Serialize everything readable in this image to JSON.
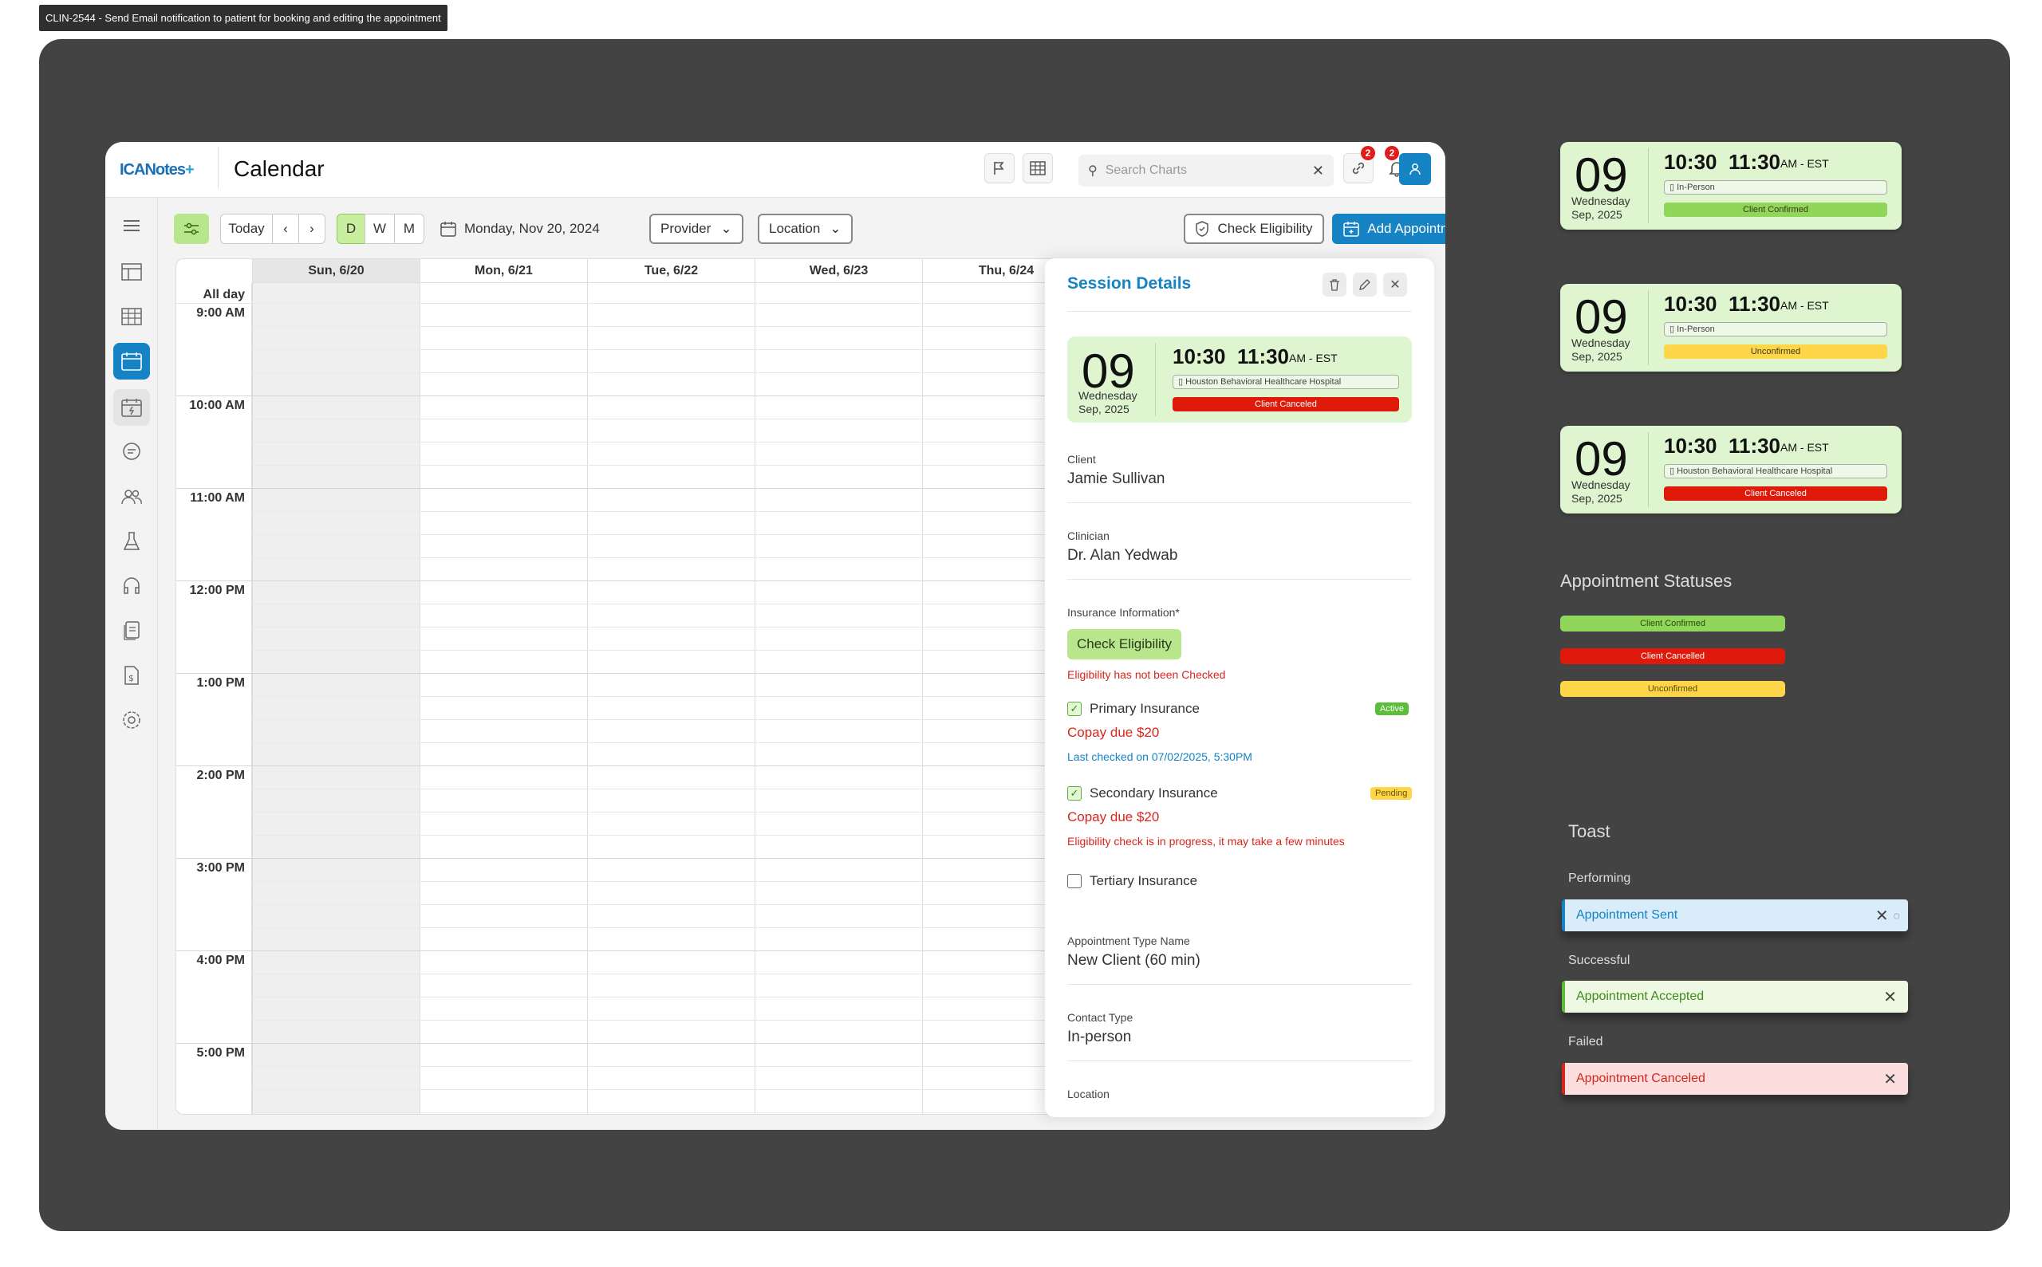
{
  "ticket": "CLIN-2544 - Send Email notification to patient for booking and editing the appointment",
  "app": {
    "logo": "ICANotes",
    "logo_mark": "+",
    "title": "Calendar",
    "search_placeholder": "Search Charts",
    "link_badge": "2",
    "bell_badge": "2"
  },
  "toolbar": {
    "today": "Today",
    "prev": "‹",
    "next": "›",
    "view_d": "D",
    "view_w": "W",
    "view_m": "M",
    "date": "Monday, Nov 20, 2024",
    "provider": "Provider",
    "location": "Location",
    "check_eligibility": "Check Eligibility",
    "add_appointment": "Add Appointment"
  },
  "calendar": {
    "days": [
      "Sun, 6/20",
      "Mon, 6/21",
      "Tue, 6/22",
      "Wed, 6/23",
      "Thu, 6/24"
    ],
    "all_day": "All day",
    "hours": [
      "9:00 AM",
      "10:00 AM",
      "11:00 AM",
      "12:00 PM",
      "1:00 PM",
      "2:00 PM",
      "3:00 PM",
      "4:00 PM",
      "5:00 PM"
    ]
  },
  "panel": {
    "title": "Session Details",
    "card": {
      "day": "09",
      "dow": "Wednesday",
      "date": "Sep, 2025",
      "start": "10:30",
      "end": "11:30",
      "tz": "AM - EST",
      "location": "Houston Behavioral Healthcare Hospital",
      "status": "Client Canceled"
    },
    "client_label": "Client",
    "client": "Jamie Sullivan",
    "clinician_label": "Clinician",
    "clinician": "Dr. Alan Yedwab",
    "insurance_label": "Insurance Information*",
    "check_eligibility": "Check Eligibility",
    "eligibility_note": "Eligibility has not been Checked",
    "primary": "Primary Insurance",
    "primary_badge": "Active",
    "primary_copay": "Copay due $20",
    "primary_checked": "Last checked on 07/02/2025, 5:30PM",
    "secondary": "Secondary Insurance",
    "secondary_badge": "Pending",
    "secondary_copay": "Copay due $20",
    "secondary_note": "Eligibility check is in progress, it may take a few minutes",
    "tertiary": "Tertiary Insurance",
    "appt_type_label": "Appointment Type Name",
    "appt_type": "New Client (60 min)",
    "contact_label": "Contact Type",
    "contact": "In-person",
    "location_label": "Location"
  },
  "cards": [
    {
      "day": "09",
      "dow": "Wednesday",
      "date": "Sep, 2025",
      "start": "10:30",
      "end": "11:30",
      "tz": "AM - EST",
      "location": "In-Person",
      "status": "Client Confirmed",
      "status_color": "#8fd65a"
    },
    {
      "day": "09",
      "dow": "Wednesday",
      "date": "Sep, 2025",
      "start": "10:30",
      "end": "11:30",
      "tz": "AM - EST",
      "location": "In-Person",
      "status": "Unconfirmed",
      "status_color": "#ffd54a"
    },
    {
      "day": "09",
      "dow": "Wednesday",
      "date": "Sep, 2025",
      "start": "10:30",
      "end": "11:30",
      "tz": "AM - EST",
      "location": "Houston Behavioral Healthcare Hospital",
      "status": "Client Canceled",
      "status_color": "#e01a0a"
    }
  ],
  "statuses": {
    "title": "Appointment Statuses",
    "confirmed": "Client Confirmed",
    "cancelled": "Client Cancelled",
    "unconfirmed": "Unconfirmed"
  },
  "toast": {
    "title": "Toast",
    "performing_label": "Performing",
    "performing": "Appointment Sent",
    "successful_label": "Successful",
    "successful": "Appointment Accepted",
    "failed_label": "Failed",
    "failed": "Appointment Canceled"
  }
}
